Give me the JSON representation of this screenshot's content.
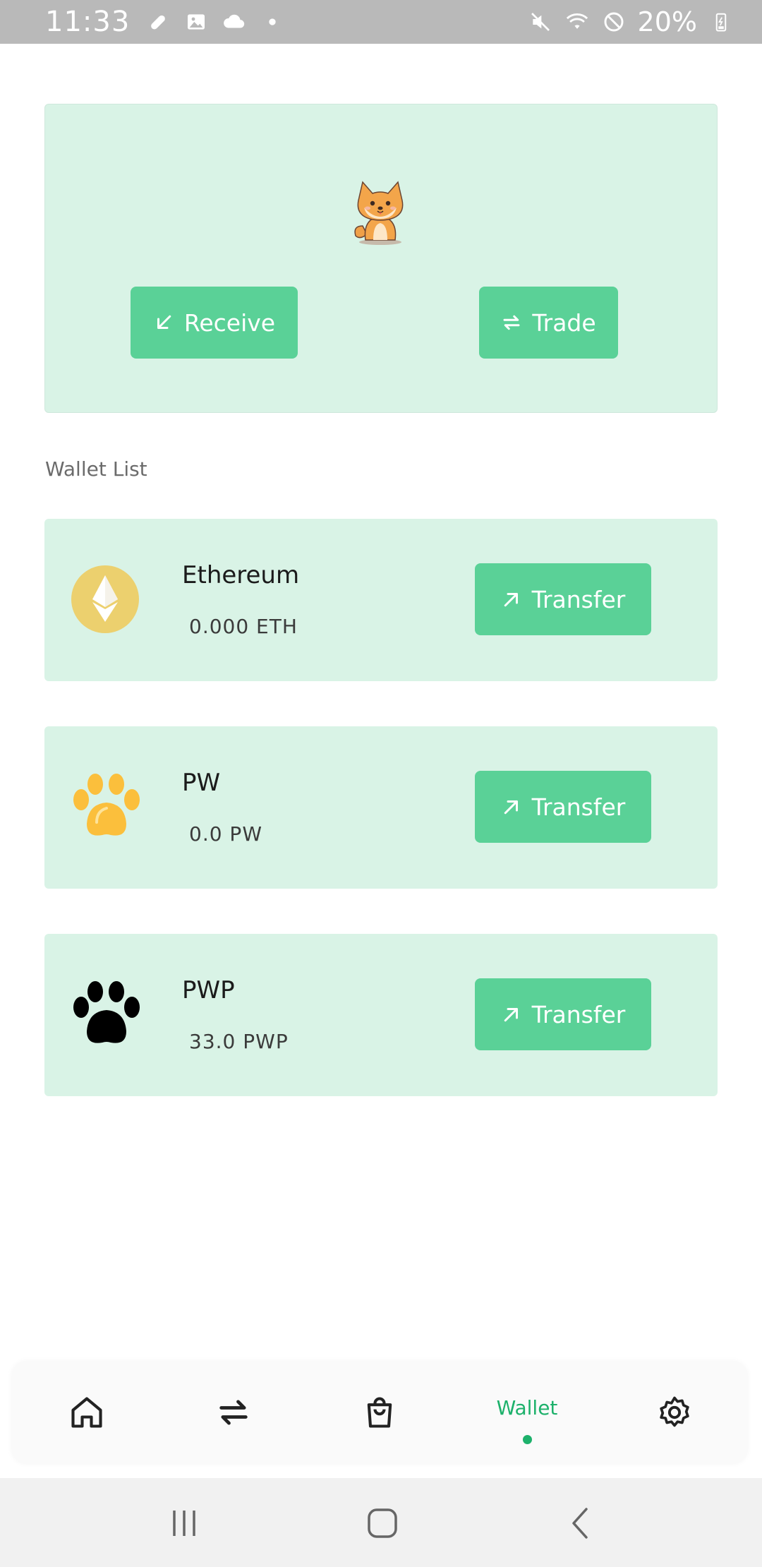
{
  "status_bar": {
    "time": "11:33",
    "battery": "20%",
    "icons_left": [
      "pill-icon",
      "image-icon",
      "cloud-icon",
      "dot-icon"
    ],
    "icons_right": [
      "mute-icon",
      "wifi-icon",
      "no-disturb-icon",
      "battery-icon"
    ]
  },
  "hero": {
    "mascot": "shiba-dog-mascot",
    "receive_label": "Receive",
    "trade_label": "Trade"
  },
  "wallet_list": {
    "title": "Wallet List",
    "items": [
      {
        "name": "Ethereum",
        "balance": "0.000 ETH",
        "icon": "ethereum-icon",
        "action": "Transfer"
      },
      {
        "name": "PW",
        "balance": "0.0 PW",
        "icon": "paw-gold-icon",
        "action": "Transfer"
      },
      {
        "name": "PWP",
        "balance": "33.0 PWP",
        "icon": "paw-black-icon",
        "action": "Transfer"
      }
    ]
  },
  "bottom_nav": {
    "items": [
      {
        "label": "",
        "icon": "home-icon"
      },
      {
        "label": "",
        "icon": "swap-icon"
      },
      {
        "label": "",
        "icon": "shopping-bag-icon"
      },
      {
        "label": "Wallet",
        "icon": "wallet",
        "active": true
      },
      {
        "label": "",
        "icon": "settings-icon"
      }
    ]
  },
  "colors": {
    "accent": "#5ad197",
    "card_bg": "#d9f3e6",
    "active_nav": "#1db16b"
  }
}
